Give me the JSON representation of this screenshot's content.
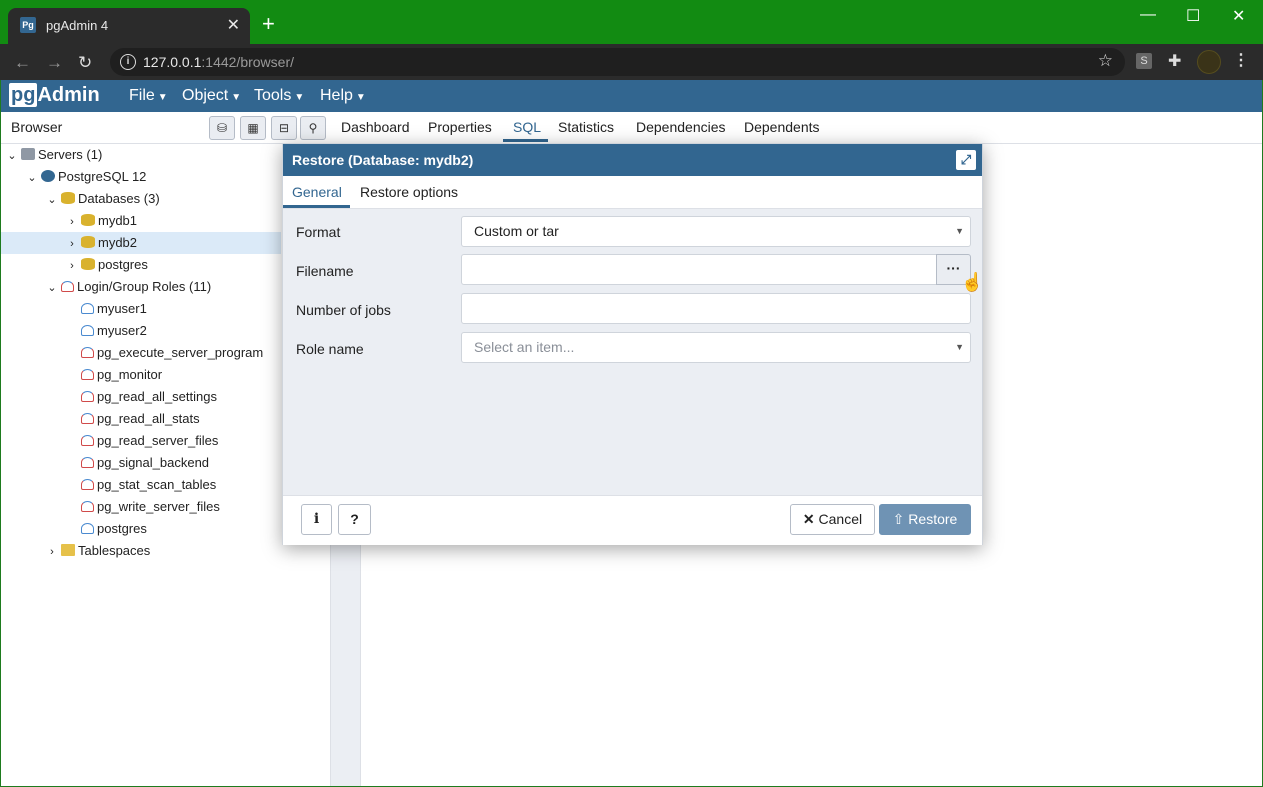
{
  "chrome": {
    "tab_title": "pgAdmin 4",
    "tab_favicon": "Pg",
    "url_host": "127.0.0.1",
    "url_rest": ":1442/browser/",
    "ext_label": "S"
  },
  "app": {
    "logo_pg": "pg",
    "logo_admin": "Admin",
    "menus": [
      "File",
      "Object",
      "Tools",
      "Help"
    ]
  },
  "browser": {
    "title": "Browser",
    "tabs": [
      "Dashboard",
      "Properties",
      "SQL",
      "Statistics",
      "Dependencies",
      "Dependents"
    ],
    "active_tab": "SQL",
    "tree": [
      {
        "label": "Servers (1)",
        "icon": "servers-icon"
      },
      {
        "label": "PostgreSQL 12",
        "icon": "postgres-server-icon"
      },
      {
        "label": "Databases (3)",
        "icon": "databases-icon"
      },
      {
        "label": "mydb1",
        "icon": "database-icon"
      },
      {
        "label": "mydb2",
        "icon": "database-icon"
      },
      {
        "label": "postgres",
        "icon": "database-icon"
      },
      {
        "label": "Login/Group Roles (11)",
        "icon": "roles-icon"
      },
      {
        "label": "myuser1",
        "icon": "user-icon"
      },
      {
        "label": "myuser2",
        "icon": "user-icon"
      },
      {
        "label": "pg_execute_server_program",
        "icon": "group-role-icon"
      },
      {
        "label": "pg_monitor",
        "icon": "group-role-icon"
      },
      {
        "label": "pg_read_all_settings",
        "icon": "group-role-icon"
      },
      {
        "label": "pg_read_all_stats",
        "icon": "group-role-icon"
      },
      {
        "label": "pg_read_server_files",
        "icon": "group-role-icon"
      },
      {
        "label": "pg_signal_backend",
        "icon": "group-role-icon"
      },
      {
        "label": "pg_stat_scan_tables",
        "icon": "group-role-icon"
      },
      {
        "label": "pg_write_server_files",
        "icon": "group-role-icon"
      },
      {
        "label": "postgres",
        "icon": "user-icon"
      },
      {
        "label": "Tablespaces",
        "icon": "tablespaces-icon"
      }
    ],
    "selected": "mydb2"
  },
  "dialog": {
    "title": "Restore (Database: mydb2)",
    "tabs": [
      "General",
      "Restore options"
    ],
    "active_tab": "General",
    "fields": {
      "format_label": "Format",
      "format_value": "Custom or tar",
      "filename_label": "Filename",
      "filename_value": "",
      "browse_label": "···",
      "jobs_label": "Number of jobs",
      "jobs_value": "",
      "role_label": "Role name",
      "role_placeholder": "Select an item..."
    },
    "buttons": {
      "info": "i",
      "help": "?",
      "cancel": "Cancel",
      "restore": "Restore"
    }
  },
  "colors": {
    "chrome_frame": "#128b12",
    "pgadmin_blue": "#326690",
    "restore_button": "#6f93b4"
  }
}
